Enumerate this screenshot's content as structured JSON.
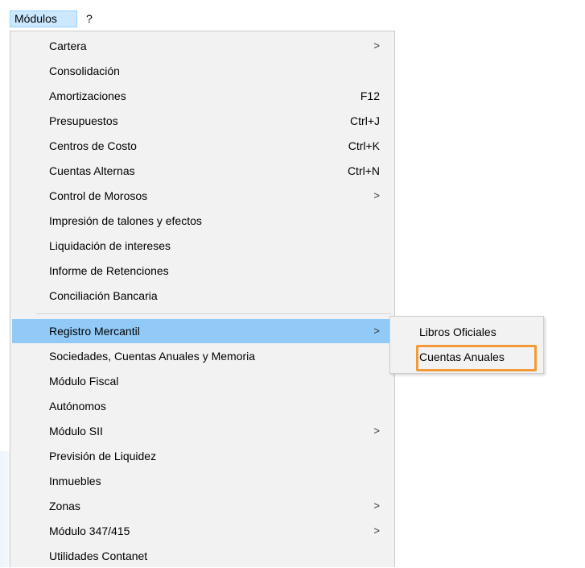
{
  "menubar": {
    "items": [
      {
        "label": "Módulos"
      },
      {
        "label": "?"
      }
    ]
  },
  "menu": {
    "items": [
      {
        "label": "Cartera",
        "shortcut": "",
        "submenu": true
      },
      {
        "label": "Consolidación",
        "shortcut": "",
        "submenu": false
      },
      {
        "label": "Amortizaciones",
        "shortcut": "F12",
        "submenu": false
      },
      {
        "label": "Presupuestos",
        "shortcut": "Ctrl+J",
        "submenu": false
      },
      {
        "label": "Centros de Costo",
        "shortcut": "Ctrl+K",
        "submenu": false
      },
      {
        "label": "Cuentas Alternas",
        "shortcut": "Ctrl+N",
        "submenu": false
      },
      {
        "label": "Control de Morosos",
        "shortcut": "",
        "submenu": true
      },
      {
        "label": "Impresión de talones y efectos",
        "shortcut": "",
        "submenu": false
      },
      {
        "label": "Liquidación de intereses",
        "shortcut": "",
        "submenu": false
      },
      {
        "label": "Informe de Retenciones",
        "shortcut": "",
        "submenu": false
      },
      {
        "label": "Conciliación Bancaria",
        "shortcut": "",
        "submenu": false
      },
      {
        "label": "Registro Mercantil",
        "shortcut": "",
        "submenu": true,
        "highlighted": true
      },
      {
        "label": "Sociedades, Cuentas Anuales y Memoria",
        "shortcut": "",
        "submenu": false
      },
      {
        "label": "Módulo Fiscal",
        "shortcut": "",
        "submenu": false
      },
      {
        "label": "Autónomos",
        "shortcut": "",
        "submenu": false
      },
      {
        "label": "Módulo SII",
        "shortcut": "",
        "submenu": true
      },
      {
        "label": "Previsión de Liquidez",
        "shortcut": "",
        "submenu": false
      },
      {
        "label": "Inmuebles",
        "shortcut": "",
        "submenu": false
      },
      {
        "label": "Zonas",
        "shortcut": "",
        "submenu": true
      },
      {
        "label": "Módulo 347/415",
        "shortcut": "",
        "submenu": true
      },
      {
        "label": "Utilidades Contanet",
        "shortcut": "",
        "submenu": false
      }
    ],
    "submenu_arrow": ">"
  },
  "submenu": {
    "items": [
      {
        "label": "Libros Oficiales"
      },
      {
        "label": "Cuentas Anuales"
      }
    ]
  },
  "colors": {
    "highlight": "#91c9f7",
    "menubar_active": "#cce8ff",
    "focus_outline": "#f39a36",
    "menu_bg": "#f2f2f2"
  }
}
